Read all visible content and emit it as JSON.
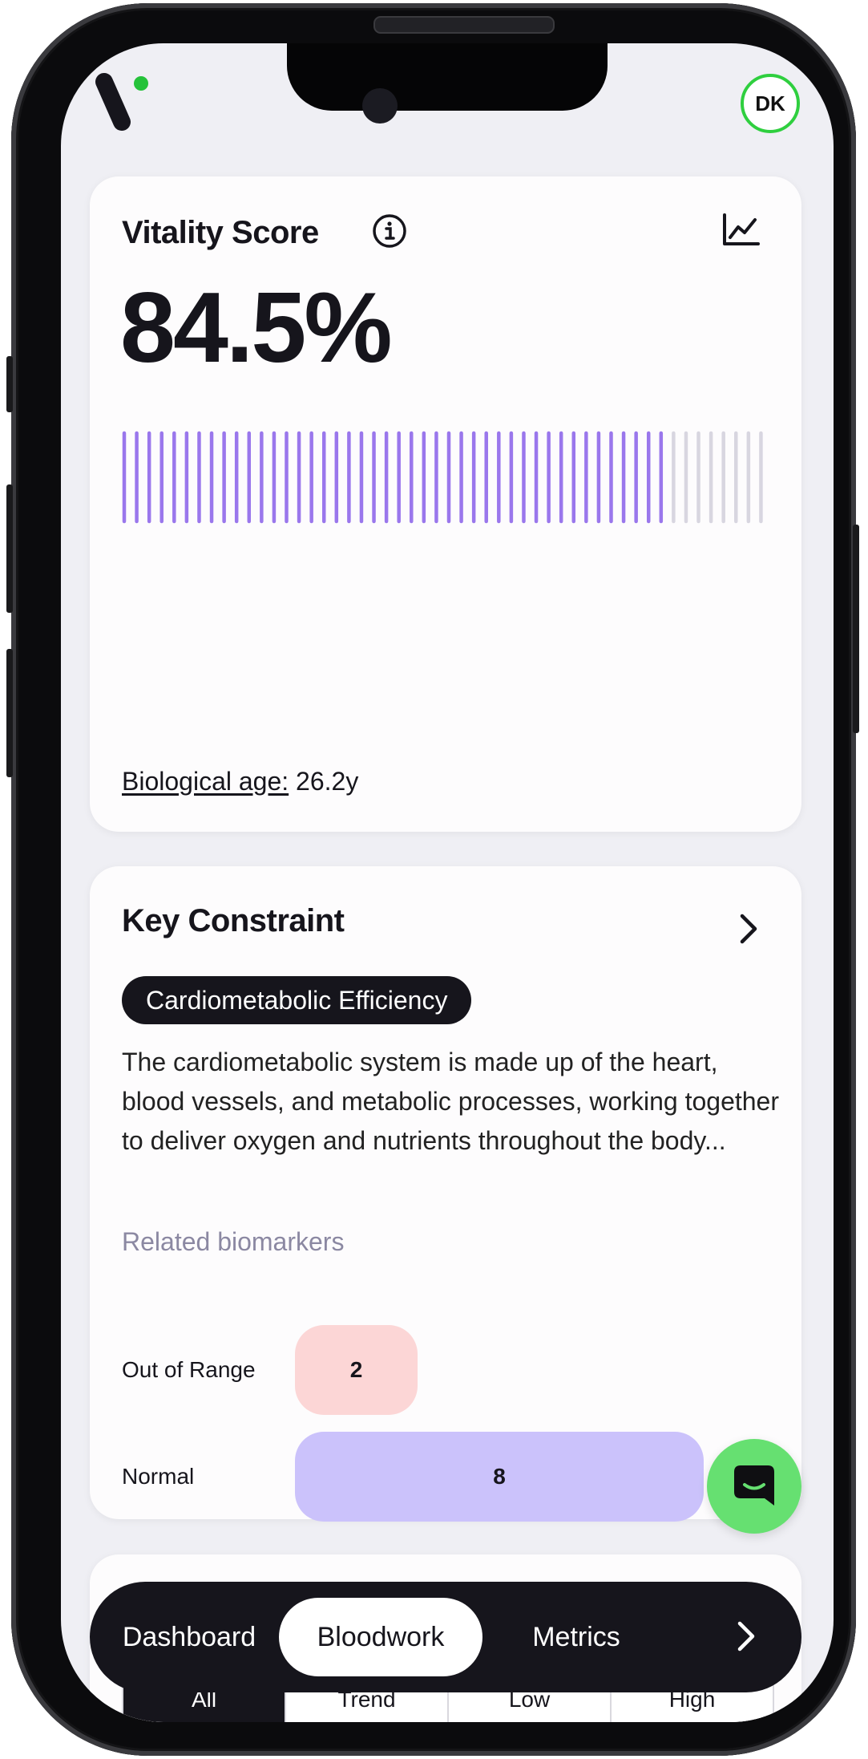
{
  "header": {
    "avatar_initials": "DK",
    "status_dot_color": "#25c23a"
  },
  "vitality": {
    "title": "Vitality Score",
    "score_text": "84.5%",
    "score_fraction": 0.845,
    "bar_fill_color": "#9a77ec",
    "bar_empty_color": "#d8d6e0",
    "bio_age_label": "Biological age:",
    "bio_age_value": "26.2y"
  },
  "constraint": {
    "title": "Key Constraint",
    "tag": "Cardiometabolic Efficiency",
    "description": "The cardiometabolic system is made up of the heart, blood vessels, and metabolic processes, working together to deliver oxygen and nutrients throughout the body...",
    "related_label": "Related biomarkers",
    "out_of_range_label": "Out of Range",
    "out_of_range_count": "2",
    "normal_label": "Normal",
    "normal_count": "8"
  },
  "filter_tabs": [
    "All",
    "Trend",
    "Low",
    "High"
  ],
  "nav": {
    "tabs": [
      "Dashboard",
      "Bloodwork",
      "Metrics"
    ],
    "active": "Bloodwork"
  }
}
